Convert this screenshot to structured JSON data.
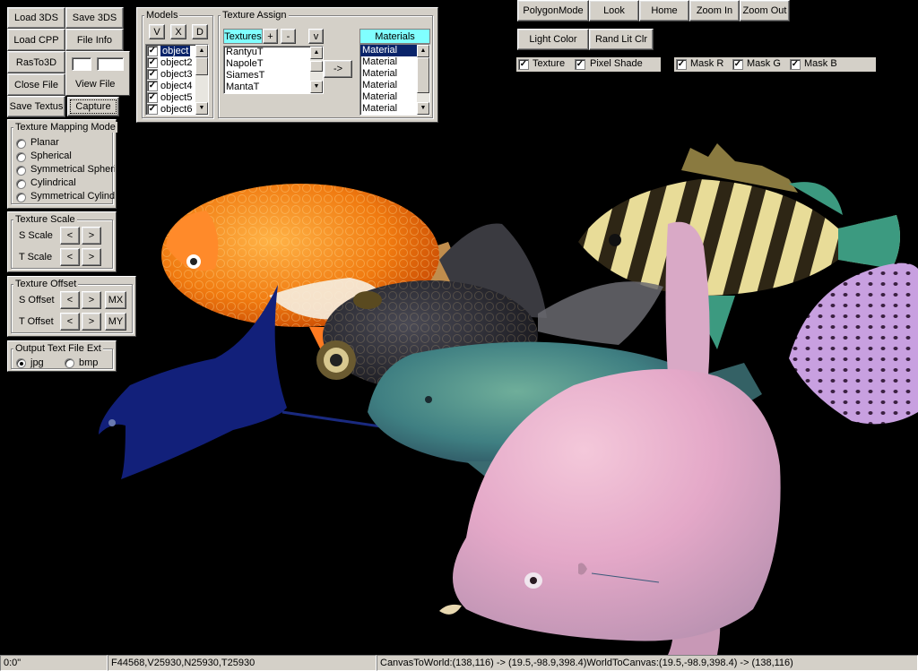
{
  "left_buttons": {
    "load_3ds": "Load 3DS",
    "save_3ds": "Save 3DS",
    "load_cpp": "Load CPP",
    "file_info": "File Info",
    "ras_to_3d": "RasTo3D",
    "view_file": "View File",
    "close_file": "Close File",
    "save_textus": "Save Textus",
    "capture": "Capture"
  },
  "mapping": {
    "title": "Texture Mapping Mode",
    "options": [
      "Planar",
      "Spherical",
      "Symmetrical Spheric",
      "Cylindrical",
      "Symmetrical Cylindri"
    ]
  },
  "scale": {
    "title": "Texture Scale",
    "s_label": "S Scale",
    "t_label": "T Scale",
    "left": "<",
    "right": ">"
  },
  "offset": {
    "title": "Texture Offset",
    "s_label": "S Offset",
    "t_label": "T Offset",
    "mx": "MX",
    "my": "MY",
    "left": "<",
    "right": ">"
  },
  "output": {
    "title": "Output Text File Ext",
    "jpg": "jpg",
    "bmp": "bmp"
  },
  "models": {
    "title": "Models",
    "btn_v": "V",
    "btn_x": "X",
    "btn_d": "D",
    "items": [
      "object",
      "object2",
      "object3",
      "object4",
      "object5",
      "object6"
    ]
  },
  "texture_assign": {
    "title": "Texture Assign",
    "textures_header": "Textures",
    "plus": "+",
    "minus": "-",
    "v": "v",
    "arrow": "->",
    "textures": [
      "RantyuT",
      "NapoleT",
      "SiamesT",
      "MantaT"
    ],
    "materials_header": "Materials",
    "materials": [
      "Material",
      "Material",
      "Material",
      "Material",
      "Material",
      "Material"
    ]
  },
  "top_right": {
    "polygon_mode": "PolygonMode",
    "look": "Look",
    "home": "Home",
    "zoom_in": "Zoom In",
    "zoom_out": "Zoom Out",
    "light_color": "Light Color",
    "rand_lit_clr": "Rand Lit Clr",
    "texture": "Texture",
    "pixel_shade": "Pixel Shade",
    "mask_r": "Mask R",
    "mask_g": "Mask G",
    "mask_b": "Mask B"
  },
  "status": {
    "pos": "0:0\"",
    "stats": "F44568,V25930,N25930,T25930",
    "coords": "CanvasToWorld:(138,116) -> (19.5,-98.9,398.4)WorldToCanvas:(19.5,-98.9,398.4) -> (138,116)"
  },
  "check_mark": "✓"
}
